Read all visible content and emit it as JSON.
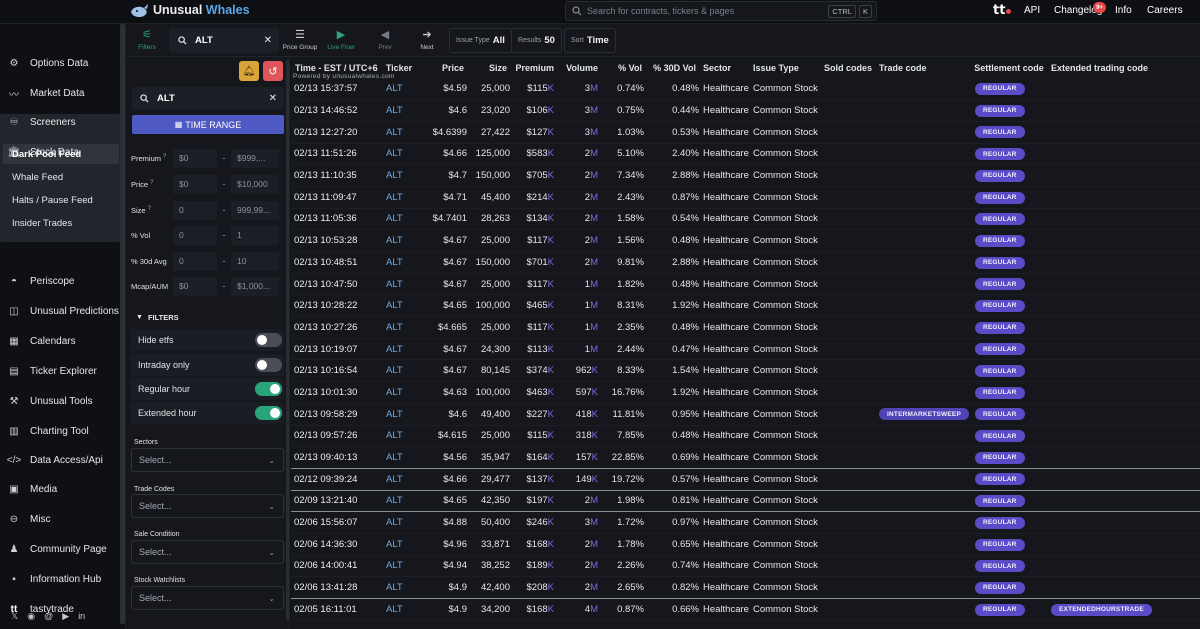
{
  "brand": {
    "name_a": "Unusual",
    "name_b": "Whales"
  },
  "search": {
    "placeholder": "Search for contracts, tickers & pages",
    "kbd1": "CTRL",
    "kbd2": "K"
  },
  "topnav": [
    "API",
    "Changelog",
    "Info",
    "Careers"
  ],
  "changelog_badge": "9+",
  "sidebar": {
    "items": [
      {
        "label": "Options Data",
        "icon": "options-icon"
      },
      {
        "label": "Market Data",
        "icon": "pulse-icon"
      },
      {
        "label": "Screeners",
        "icon": "binoculars-icon"
      },
      {
        "label": "Stock Data",
        "icon": "bank-icon"
      },
      {
        "label": "Periscope",
        "icon": "periscope-icon"
      },
      {
        "label": "Unusual Predictions",
        "icon": "predictions-icon"
      },
      {
        "label": "Calendars",
        "icon": "calendar-icon"
      },
      {
        "label": "Ticker Explorer",
        "icon": "explorer-icon"
      },
      {
        "label": "Unusual Tools",
        "icon": "tools-icon"
      },
      {
        "label": "Charting Tool",
        "icon": "chart-icon"
      },
      {
        "label": "Data Access/Api",
        "icon": "code-icon"
      },
      {
        "label": "Media",
        "icon": "media-icon"
      },
      {
        "label": "Misc",
        "icon": "misc-icon"
      },
      {
        "label": "Community Page",
        "icon": "community-icon"
      },
      {
        "label": "Information Hub",
        "icon": "info-hub-icon"
      },
      {
        "label": "tastytrade",
        "icon": "tastytrade-icon"
      }
    ],
    "subitems": [
      "Dark Pool Feed",
      "Whale Feed",
      "Halts / Pause Feed",
      "Insider Trades"
    ]
  },
  "toolbar": {
    "filters": "Filters",
    "ticker_value": "ALT",
    "price_group": "Price Group",
    "live_flow": "Live Flow",
    "prev": "Prev",
    "next": "Next",
    "issue_type_label": "Issue Type",
    "issue_type_value": "All",
    "results_label": "Results",
    "results_value": "50",
    "sort_label": "Sort",
    "sort_value": "Time"
  },
  "panel": {
    "ticker": "ALT",
    "time_range": "TIME RANGE",
    "filters_header": "FILTERS",
    "ranges": [
      {
        "label": "Premium",
        "q": "?",
        "min": "$0",
        "max": "$999,..."
      },
      {
        "label": "Price",
        "q": "?",
        "min": "$0",
        "max": "$10,000"
      },
      {
        "label": "Size",
        "q": "?",
        "min": "0",
        "max": "999,99..."
      },
      {
        "label": "% Vol",
        "q": "",
        "min": "0",
        "max": "1"
      },
      {
        "label": "% 30d Avg",
        "q": "",
        "min": "0",
        "max": "10"
      },
      {
        "label": "Mcap/AUM",
        "q": "",
        "min": "$0",
        "max": "$1,000..."
      }
    ],
    "toggles": [
      {
        "label": "Hide etfs",
        "on": false
      },
      {
        "label": "Intraday only",
        "on": false
      },
      {
        "label": "Regular hour",
        "on": true
      },
      {
        "label": "Extended hour",
        "on": true
      }
    ],
    "selects": [
      {
        "label": "Sectors",
        "value": "Select..."
      },
      {
        "label": "Trade Codes",
        "value": "Select..."
      },
      {
        "label": "Sale Condition",
        "value": "Select..."
      },
      {
        "label": "Stock Watchlists",
        "value": "Select..."
      }
    ]
  },
  "table": {
    "time_header": "Time - EST / UTC+6",
    "powered": "Powered by unusualwhales.com",
    "columns": [
      "Ticker",
      "Price",
      "Size",
      "Premium",
      "Volume",
      "% Vol",
      "% 30D Vol",
      "Sector",
      "Issue Type",
      "Sold codes",
      "Trade code",
      "Settlement code",
      "Extended trading code"
    ],
    "rows": [
      [
        "02/13 15:37:57",
        "ALT",
        "$4.59",
        "25,000",
        "$115",
        "K",
        "3M",
        "0.74%",
        "0.48%",
        "Healthcare",
        "Common Stock",
        "",
        "",
        "REGULAR",
        ""
      ],
      [
        "02/13 14:46:52",
        "ALT",
        "$4.6",
        "23,020",
        "$106",
        "K",
        "3M",
        "0.75%",
        "0.44%",
        "Healthcare",
        "Common Stock",
        "",
        "",
        "REGULAR",
        ""
      ],
      [
        "02/13 12:27:20",
        "ALT",
        "$4.6399",
        "27,422",
        "$127",
        "K",
        "3M",
        "1.03%",
        "0.53%",
        "Healthcare",
        "Common Stock",
        "",
        "",
        "REGULAR",
        ""
      ],
      [
        "02/13 11:51:26",
        "ALT",
        "$4.66",
        "125,000",
        "$583",
        "K",
        "2M",
        "5.10%",
        "2.40%",
        "Healthcare",
        "Common Stock",
        "",
        "",
        "REGULAR",
        ""
      ],
      [
        "02/13 11:10:35",
        "ALT",
        "$4.7",
        "150,000",
        "$705",
        "K",
        "2M",
        "7.34%",
        "2.88%",
        "Healthcare",
        "Common Stock",
        "",
        "",
        "REGULAR",
        ""
      ],
      [
        "02/13 11:09:47",
        "ALT",
        "$4.71",
        "45,400",
        "$214",
        "K",
        "2M",
        "2.43%",
        "0.87%",
        "Healthcare",
        "Common Stock",
        "",
        "",
        "REGULAR",
        ""
      ],
      [
        "02/13 11:05:36",
        "ALT",
        "$4.7401",
        "28,263",
        "$134",
        "K",
        "2M",
        "1.58%",
        "0.54%",
        "Healthcare",
        "Common Stock",
        "",
        "",
        "REGULAR",
        ""
      ],
      [
        "02/13 10:53:28",
        "ALT",
        "$4.67",
        "25,000",
        "$117",
        "K",
        "2M",
        "1.56%",
        "0.48%",
        "Healthcare",
        "Common Stock",
        "",
        "",
        "REGULAR",
        ""
      ],
      [
        "02/13 10:48:51",
        "ALT",
        "$4.67",
        "150,000",
        "$701",
        "K",
        "2M",
        "9.81%",
        "2.88%",
        "Healthcare",
        "Common Stock",
        "",
        "",
        "REGULAR",
        ""
      ],
      [
        "02/13 10:47:50",
        "ALT",
        "$4.67",
        "25,000",
        "$117",
        "K",
        "1M",
        "1.82%",
        "0.48%",
        "Healthcare",
        "Common Stock",
        "",
        "",
        "REGULAR",
        ""
      ],
      [
        "02/13 10:28:22",
        "ALT",
        "$4.65",
        "100,000",
        "$465",
        "K",
        "1M",
        "8.31%",
        "1.92%",
        "Healthcare",
        "Common Stock",
        "",
        "",
        "REGULAR",
        ""
      ],
      [
        "02/13 10:27:26",
        "ALT",
        "$4.665",
        "25,000",
        "$117",
        "K",
        "1M",
        "2.35%",
        "0.48%",
        "Healthcare",
        "Common Stock",
        "",
        "",
        "REGULAR",
        ""
      ],
      [
        "02/13 10:19:07",
        "ALT",
        "$4.67",
        "24,300",
        "$113",
        "K",
        "1M",
        "2.44%",
        "0.47%",
        "Healthcare",
        "Common Stock",
        "",
        "",
        "REGULAR",
        ""
      ],
      [
        "02/13 10:16:54",
        "ALT",
        "$4.67",
        "80,145",
        "$374",
        "K",
        "962K",
        "8.33%",
        "1.54%",
        "Healthcare",
        "Common Stock",
        "",
        "",
        "REGULAR",
        ""
      ],
      [
        "02/13 10:01:30",
        "ALT",
        "$4.63",
        "100,000",
        "$463",
        "K",
        "597K",
        "16.76%",
        "1.92%",
        "Healthcare",
        "Common Stock",
        "",
        "",
        "REGULAR",
        ""
      ],
      [
        "02/13 09:58:29",
        "ALT",
        "$4.6",
        "49,400",
        "$227",
        "K",
        "418K",
        "11.81%",
        "0.95%",
        "Healthcare",
        "Common Stock",
        "",
        "INTERMARKETSWEEP",
        "REGULAR",
        ""
      ],
      [
        "02/13 09:57:26",
        "ALT",
        "$4.615",
        "25,000",
        "$115",
        "K",
        "318K",
        "7.85%",
        "0.48%",
        "Healthcare",
        "Common Stock",
        "",
        "",
        "REGULAR",
        ""
      ],
      [
        "02/13 09:40:13",
        "ALT",
        "$4.56",
        "35,947",
        "$164",
        "K",
        "157K",
        "22.85%",
        "0.69%",
        "Healthcare",
        "Common Stock",
        "",
        "",
        "REGULAR",
        ""
      ],
      [
        "02/12 09:39:24",
        "ALT",
        "$4.66",
        "29,477",
        "$137",
        "K",
        "149K",
        "19.72%",
        "0.57%",
        "Healthcare",
        "Common Stock",
        "",
        "",
        "REGULAR",
        ""
      ],
      [
        "02/09 13:21:40",
        "ALT",
        "$4.65",
        "42,350",
        "$197",
        "K",
        "2M",
        "1.98%",
        "0.81%",
        "Healthcare",
        "Common Stock",
        "",
        "",
        "REGULAR",
        ""
      ],
      [
        "02/06 15:56:07",
        "ALT",
        "$4.88",
        "50,400",
        "$246",
        "K",
        "3M",
        "1.72%",
        "0.97%",
        "Healthcare",
        "Common Stock",
        "",
        "",
        "REGULAR",
        ""
      ],
      [
        "02/06 14:36:30",
        "ALT",
        "$4.96",
        "33,871",
        "$168",
        "K",
        "2M",
        "1.78%",
        "0.65%",
        "Healthcare",
        "Common Stock",
        "",
        "",
        "REGULAR",
        ""
      ],
      [
        "02/06 14:00:41",
        "ALT",
        "$4.94",
        "38,252",
        "$189",
        "K",
        "2M",
        "2.26%",
        "0.74%",
        "Healthcare",
        "Common Stock",
        "",
        "",
        "REGULAR",
        ""
      ],
      [
        "02/06 13:41:28",
        "ALT",
        "$4.9",
        "42,400",
        "$208",
        "K",
        "2M",
        "2.65%",
        "0.82%",
        "Healthcare",
        "Common Stock",
        "",
        "",
        "REGULAR",
        ""
      ],
      [
        "02/05 16:11:01",
        "ALT",
        "$4.9",
        "34,200",
        "$168",
        "K",
        "4M",
        "0.87%",
        "0.66%",
        "Healthcare",
        "Common Stock",
        "",
        "",
        "REGULAR",
        "EXTENDEDHOURSTRADE"
      ]
    ]
  }
}
